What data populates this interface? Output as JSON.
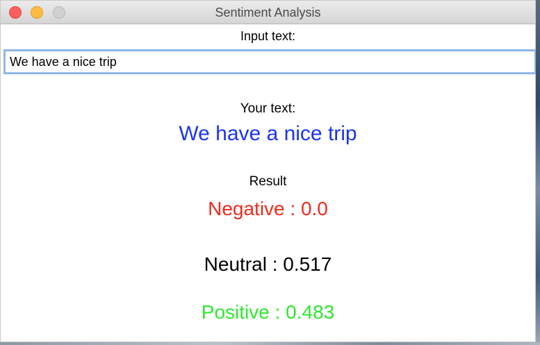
{
  "window": {
    "title": "Sentiment Analysis"
  },
  "input": {
    "label": "Input text:",
    "value": "We have a nice trip"
  },
  "echo": {
    "label": "Your text:",
    "value": "We have a nice trip"
  },
  "result": {
    "label": "Result",
    "negative": "Negative : 0.0",
    "neutral": "Neutral : 0.517",
    "positive": "Positive : 0.483"
  },
  "colors": {
    "echo_text": "#1a33f5",
    "negative": "#f22a1c",
    "neutral": "#000000",
    "positive": "#2ee82e"
  }
}
